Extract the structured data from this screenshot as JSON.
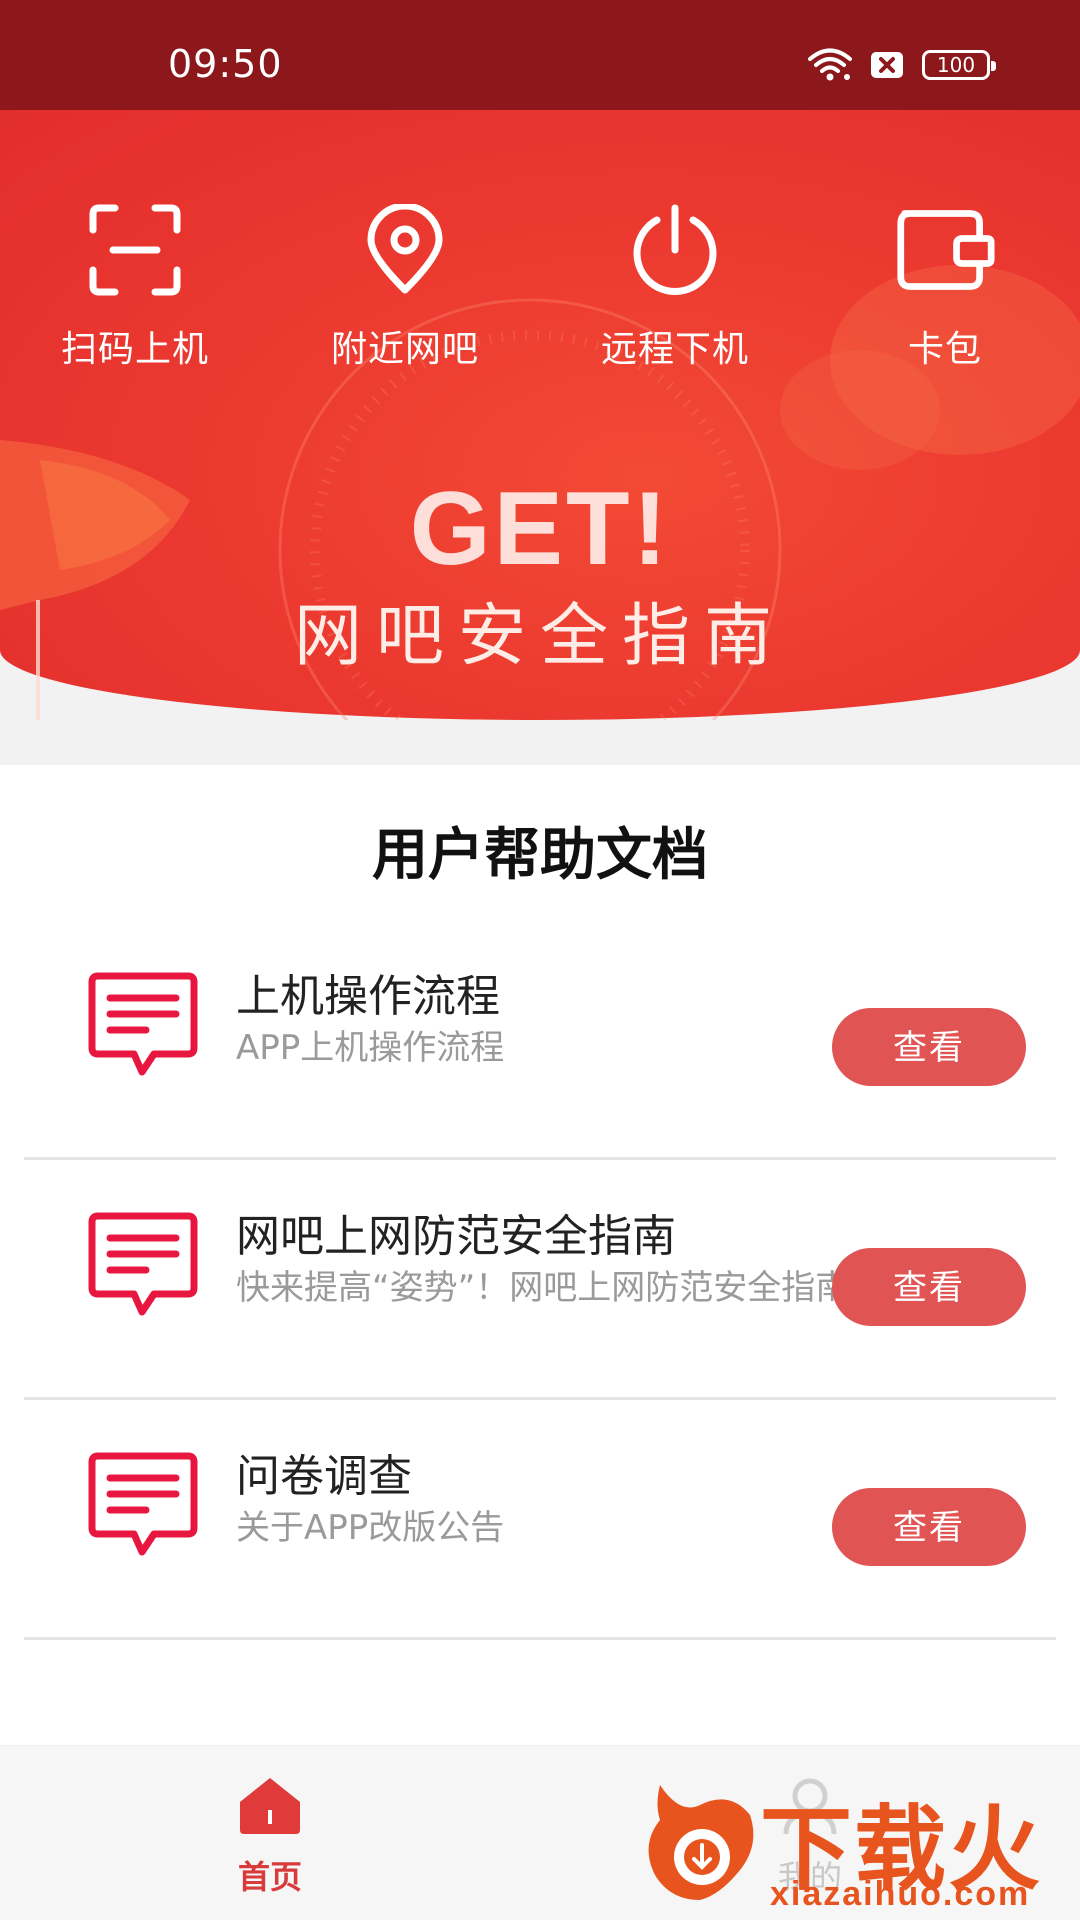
{
  "status_bar": {
    "time": "09:50",
    "battery": "100",
    "icons": [
      "wifi-icon",
      "sim-off-icon",
      "battery-icon"
    ]
  },
  "quick_nav": [
    {
      "label": "扫码上机",
      "icon": "scan-icon"
    },
    {
      "label": "附近网吧",
      "icon": "location-pin-icon"
    },
    {
      "label": "远程下机",
      "icon": "power-icon"
    },
    {
      "label": "卡包",
      "icon": "wallet-icon"
    }
  ],
  "banner": {
    "headline": "GET!",
    "subtitle": "网吧安全指南"
  },
  "help": {
    "title": "用户帮助文档",
    "items": [
      {
        "title": "上机操作流程",
        "subtitle": "APP上机操作流程",
        "button": "查看"
      },
      {
        "title": "网吧上网防范安全指南",
        "subtitle": "快来提高“姿势”！网吧上网防范安全指南",
        "button": "查看"
      },
      {
        "title": "问卷调查",
        "subtitle": "关于APP改版公告",
        "button": "查看"
      }
    ]
  },
  "tabbar": {
    "home": "首页",
    "mine": "我的"
  },
  "watermark": {
    "name": "下载火",
    "url": "xiazaihuo.com"
  },
  "colors": {
    "status_bar": "#8c181c",
    "banner": "#e8352f",
    "accent_button": "#e05454",
    "icon_red": "#e8173f"
  }
}
